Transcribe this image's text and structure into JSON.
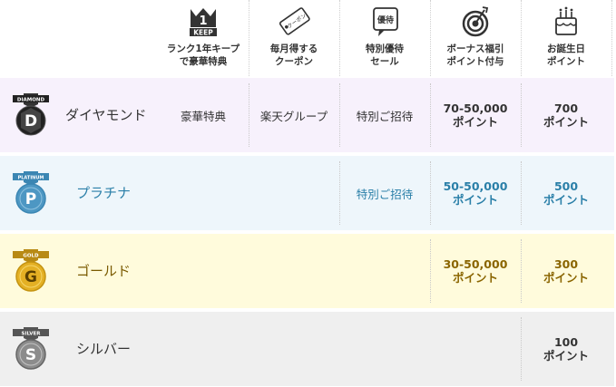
{
  "header": {
    "columns": [
      {
        "icon": "keep-crown-icon",
        "icon_text": "1",
        "icon_caption": "KEEP",
        "label": "ランク1年キープ\nで豪華特典"
      },
      {
        "icon": "coupon-icon",
        "icon_text": "クーポン",
        "label": "毎月得する\nクーポン"
      },
      {
        "icon": "speech-bubble-icon",
        "icon_text": "優待",
        "label": "特別優待\nセール"
      },
      {
        "icon": "target-icon",
        "label": "ボーナス福引\nポイント付与"
      },
      {
        "icon": "birthday-cake-icon",
        "label": "お誕生日\nポイント"
      }
    ]
  },
  "ranks": [
    {
      "name": "ダイヤモンド",
      "badge_text": "DIAMOND",
      "badge_letter": "D",
      "keep": "豪華特典",
      "coupon": "楽天グループ",
      "sale": "特別ご招待",
      "bonus": "70-50,000\nポイント",
      "birthday": "700\nポイント",
      "colors": {
        "bg": "#f7f1fc",
        "badge": "#222222",
        "ribbon": "#333333"
      }
    },
    {
      "name": "プラチナ",
      "badge_text": "PLATINUM",
      "badge_letter": "P",
      "keep": "",
      "coupon": "",
      "sale": "特別ご招待",
      "bonus": "50-50,000\nポイント",
      "birthday": "500\nポイント",
      "colors": {
        "bg": "#eef6fb",
        "badge": "#4d97c3",
        "ribbon": "#3b86b3"
      }
    },
    {
      "name": "ゴールド",
      "badge_text": "GOLD",
      "badge_letter": "G",
      "keep": "",
      "coupon": "",
      "sale": "",
      "bonus": "30-50,000\nポイント",
      "birthday": "300\nポイント",
      "colors": {
        "bg": "#fffbdc",
        "badge": "#e4b024",
        "ribbon": "#b88a14"
      }
    },
    {
      "name": "シルバー",
      "badge_text": "SILVER",
      "badge_letter": "S",
      "keep": "",
      "coupon": "",
      "sale": "",
      "bonus": "",
      "birthday": "100\nポイント",
      "colors": {
        "bg": "#efefef",
        "badge": "#8c8c8c",
        "ribbon": "#555555"
      }
    }
  ]
}
